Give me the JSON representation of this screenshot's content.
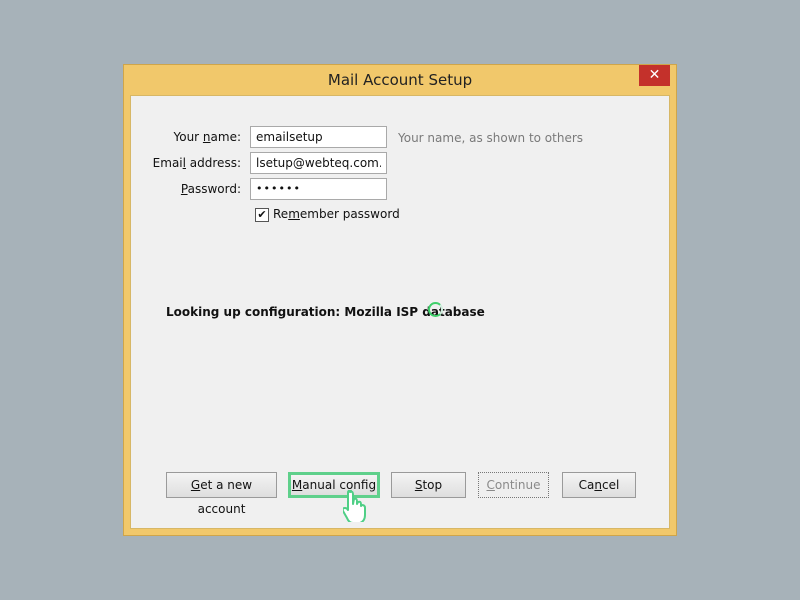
{
  "window": {
    "title": "Mail Account Setup",
    "close_symbol": "✕"
  },
  "form": {
    "name_label_pre": "Your ",
    "name_label_ul": "n",
    "name_label_post": "ame:",
    "name_value": "emailsetup",
    "name_hint": "Your name, as shown to others",
    "email_label_pre": "Emai",
    "email_label_ul": "l",
    "email_label_post": " address:",
    "email_value": "lsetup@webteq.com.my",
    "password_label_pre": "",
    "password_label_ul": "P",
    "password_label_post": "assword:",
    "password_value": "••••••",
    "remember_checked": true,
    "remember_mark": "✔",
    "remember_label_pre": "Re",
    "remember_label_ul": "m",
    "remember_label_post": "ember password"
  },
  "status": {
    "text": "Looking up configuration: Mozilla ISP database"
  },
  "buttons": {
    "new_account_ul": "G",
    "new_account_rest": "et a new account",
    "manual_ul": "M",
    "manual_rest": "anual config",
    "stop_ul": "S",
    "stop_rest": "top",
    "continue_ul": "C",
    "continue_rest": "ontinue",
    "cancel_pre": "Ca",
    "cancel_ul": "n",
    "cancel_post": "cel"
  },
  "colors": {
    "titlebar": "#f1c86b",
    "close": "#c4312b",
    "highlight": "#5fd08b",
    "spinner": "#3fcf6a"
  }
}
